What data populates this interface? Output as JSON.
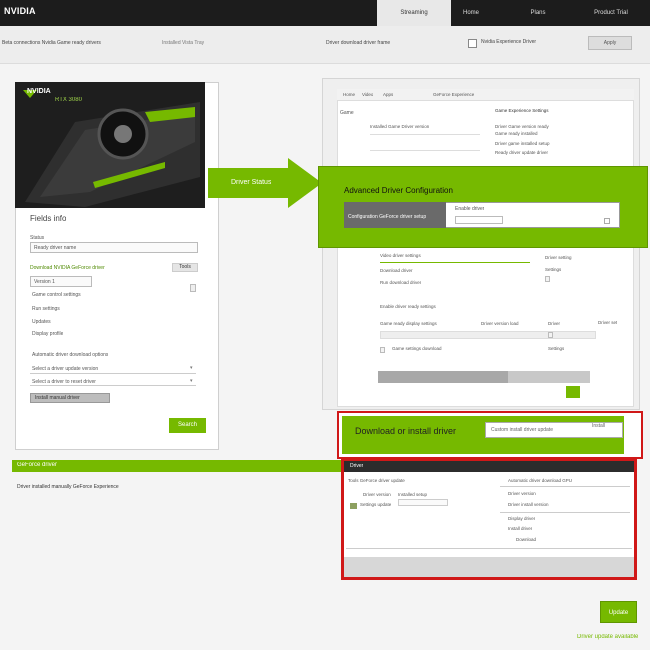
{
  "brand": {
    "logo_text": "NVIDIA",
    "accent": "#76b900",
    "alert": "#d01818"
  },
  "nav": {
    "tabs": [
      "Streaming",
      "Home",
      "Plans",
      "Product Trial"
    ]
  },
  "subheader": {
    "left_text": "Beta connections Nvidia Game ready drivers",
    "mid_text": "Installed Vista Tray",
    "right_text": "Driver download driver frame",
    "checkbox_label": "Nvidia Experience Driver",
    "button_label": "Apply"
  },
  "left_card": {
    "gpu_brand_line1": "NVIDIA",
    "gpu_brand_line2": "RTX 3080",
    "section_title": "Fields info",
    "label_status": "Status",
    "field1_value": "Ready driver name",
    "green_link": "Download NVIDIA GeForce driver",
    "small_button": "Tools",
    "field2_value": "Version 1",
    "label_game": "Game control settings",
    "label_drivers": "Run settings",
    "label_update": "Updates",
    "label_display": "Display profile",
    "info_line": "Automatic driver download options",
    "select1": "Select a driver update version",
    "select2": "Select a driver to reset driver",
    "gray_button": "Install manual driver",
    "green_button": "Search"
  },
  "right_panel": {
    "tabs": [
      "Home",
      "Video",
      "Apps",
      "GeForce Experience"
    ],
    "heading": "Game",
    "line_a": "Installed Game Driver version",
    "col_title": "Game Experience Settings",
    "col_lines": [
      "Driver Game version ready",
      "Game ready installed",
      "Driver game installed setup",
      "Ready driver update driver"
    ],
    "mid_lines": [
      "Video driver settings",
      "Download driver",
      "Run download driver",
      "Enable driver ready settings"
    ],
    "mid_right": [
      "Driver setting",
      "Settings"
    ],
    "lower_left": "Game ready display settings",
    "lower_mid": "Driver version load",
    "lower_right": "Driver",
    "lower_far": "Driver set",
    "footer_row": [
      "Game settings download",
      "Settings"
    ]
  },
  "callout": {
    "arrow_label": "Driver Status",
    "title": "Advanced Driver Configuration",
    "dark_text": "Configuration GeForce driver setup",
    "field_text": "Enable driver"
  },
  "red_box": {
    "label": "Download or install driver",
    "input_value": "Custom install driver update",
    "input_button": "Install"
  },
  "band": {
    "label": "GeForce driver",
    "text": "Driver installed manually GeForce Experience"
  },
  "lower_panel": {
    "header": "Driver",
    "line1": "Tools GeForce driver update",
    "line2": "Driver version",
    "line3": "Installed setup",
    "right_lines": [
      "Automatic driver download GPU",
      "Driver version",
      "Driver install version",
      "Display driver",
      "Install driver"
    ],
    "extra": [
      "Settings update",
      "Download"
    ]
  },
  "footer": {
    "save_button": "Update",
    "link": "Driver update available"
  }
}
